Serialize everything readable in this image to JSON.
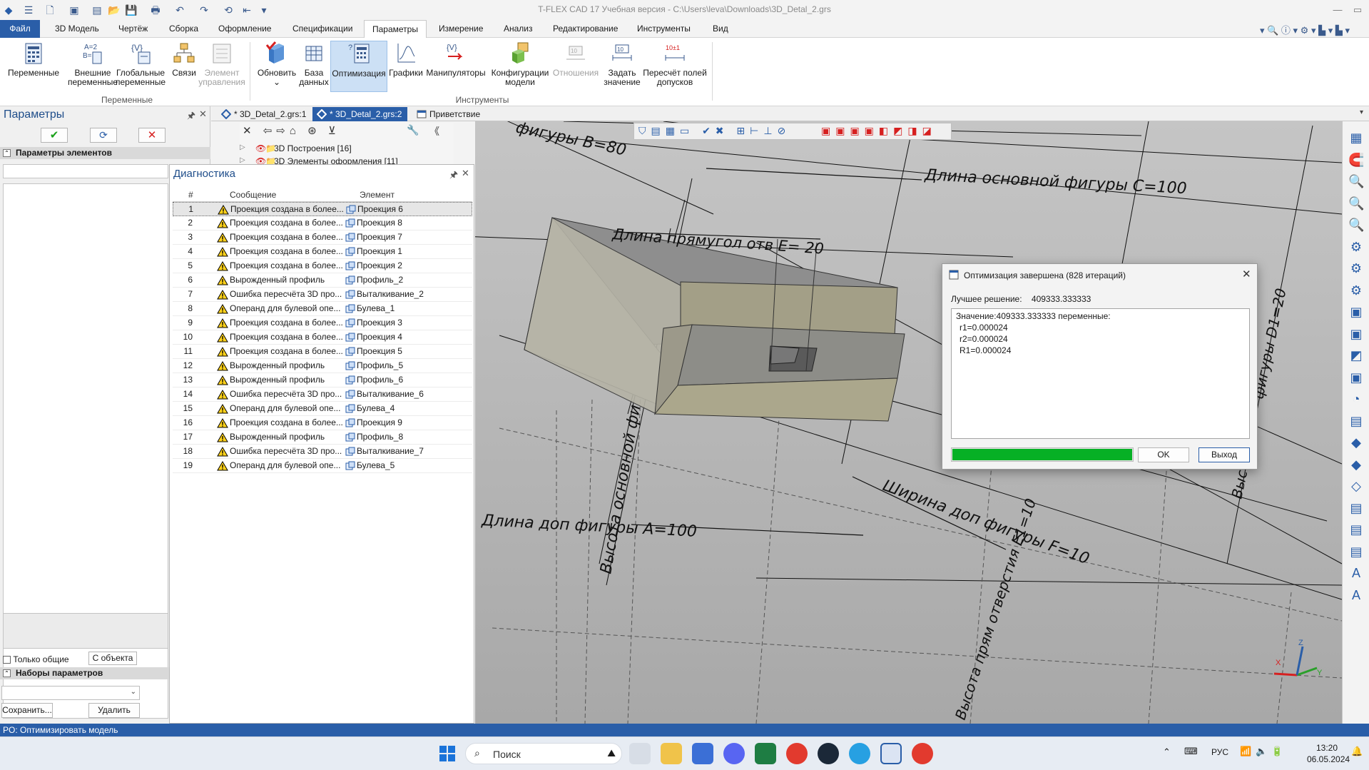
{
  "window": {
    "title": "T-FLEX CAD 17 Учебная версия - C:\\Users\\leva\\Downloads\\3D_Detal_2.grs"
  },
  "menu": {
    "tabs": [
      "Файл",
      "3D Модель",
      "Чертёж",
      "Сборка",
      "Оформление",
      "Спецификации",
      "Параметры",
      "Измерение",
      "Анализ",
      "Редактирование",
      "Инструменты",
      "Вид"
    ],
    "active": "Параметры"
  },
  "ribbon": {
    "buttons": [
      {
        "label1": "Переменные",
        "label2": ""
      },
      {
        "label1": "Внешние",
        "label2": "переменные"
      },
      {
        "label1": "Глобальные",
        "label2": "переменные"
      },
      {
        "label1": "Связи",
        "label2": ""
      },
      {
        "label1": "Элемент",
        "label2": "управления"
      },
      {
        "label1": "Обновить",
        "label2": "⌄"
      },
      {
        "label1": "База",
        "label2": "данных"
      },
      {
        "label1": "Оптимизация",
        "label2": ""
      },
      {
        "label1": "Графики",
        "label2": ""
      },
      {
        "label1": "Манипуляторы",
        "label2": ""
      },
      {
        "label1": "Конфигурации",
        "label2": "модели"
      },
      {
        "label1": "Отношения",
        "label2": ""
      },
      {
        "label1": "Задать",
        "label2": "значение"
      },
      {
        "label1": "Пересчёт полей",
        "label2": "допусков"
      }
    ],
    "groups": {
      "variables": "Переменные",
      "tools": "Инструменты"
    }
  },
  "params_panel": {
    "title": "Параметры",
    "elements_header": "Параметры элементов",
    "only_common": "Только общие",
    "from_object": "С объекта",
    "sets_header": "Наборы параметров",
    "save": "Сохранить...",
    "delete": "Удалить"
  },
  "doc_tabs": [
    {
      "label": "* 3D_Detal_2.grs:1"
    },
    {
      "label": "* 3D_Detal_2.grs:2"
    },
    {
      "label": "Приветствие"
    }
  ],
  "tree": {
    "rows": [
      "3D Построения [16]",
      "3D Элементы оформления [11]"
    ]
  },
  "diagnostics": {
    "title": "Диагностика",
    "headers": {
      "num": "#",
      "message": "Сообщение",
      "element": "Элемент"
    },
    "rows": [
      {
        "n": "1",
        "msg": "Проекция создана в более...",
        "el": "Проекция 6"
      },
      {
        "n": "2",
        "msg": "Проекция создана в более...",
        "el": "Проекция 8"
      },
      {
        "n": "3",
        "msg": "Проекция создана в более...",
        "el": "Проекция 7"
      },
      {
        "n": "4",
        "msg": "Проекция создана в более...",
        "el": "Проекция 1"
      },
      {
        "n": "5",
        "msg": "Проекция создана в более...",
        "el": "Проекция 2"
      },
      {
        "n": "6",
        "msg": "Вырожденный профиль",
        "el": "Профиль_2"
      },
      {
        "n": "7",
        "msg": "Ошибка пересчёта 3D про...",
        "el": "Выталкивание_2"
      },
      {
        "n": "8",
        "msg": "Операнд для булевой опе...",
        "el": "Булева_1"
      },
      {
        "n": "9",
        "msg": "Проекция создана в более...",
        "el": "Проекция 3"
      },
      {
        "n": "10",
        "msg": "Проекция создана в более...",
        "el": "Проекция 4"
      },
      {
        "n": "11",
        "msg": "Проекция создана в более...",
        "el": "Проекция 5"
      },
      {
        "n": "12",
        "msg": "Вырожденный профиль",
        "el": "Профиль_5"
      },
      {
        "n": "13",
        "msg": "Вырожденный профиль",
        "el": "Профиль_6"
      },
      {
        "n": "14",
        "msg": "Ошибка пересчёта 3D про...",
        "el": "Выталкивание_6"
      },
      {
        "n": "15",
        "msg": "Операнд для булевой опе...",
        "el": "Булева_4"
      },
      {
        "n": "16",
        "msg": "Проекция создана в более...",
        "el": "Проекция 9"
      },
      {
        "n": "17",
        "msg": "Вырожденный профиль",
        "el": "Профиль_8"
      },
      {
        "n": "18",
        "msg": "Ошибка пересчёта 3D про...",
        "el": "Выталкивание_7"
      },
      {
        "n": "19",
        "msg": "Операнд для булевой опе...",
        "el": "Булева_5"
      }
    ]
  },
  "viewport": {
    "dims": {
      "c": "Длина основной фигуры C=100",
      "e": "Длина прямугол отв E= 20",
      "b": "фигуры B=80",
      "dop": "Длина доп фигуры A=100",
      "wid": "Ширина доп фигуры F=10",
      "h1": "Высота основной фи",
      "h2": "Высота прям отверстия E1=10",
      "d1": "фигуры D1=20",
      "vy": "Выс"
    },
    "axes": {
      "x": "X",
      "y": "Y",
      "z": "Z"
    }
  },
  "dialog": {
    "title": "Оптимизация завершена (828 итераций)",
    "best_label": "Лучшее решение:",
    "best_value": "409333.333333",
    "lines": [
      "Значение:409333.333333 переменные:",
      "r1=0.000024",
      "r2=0.000024",
      "R1=0.000024"
    ],
    "progress": 1.0,
    "ok": "OK",
    "exit": "Выход"
  },
  "status": {
    "text": "PO: Оптимизировать модель"
  },
  "taskbar": {
    "search": "Поиск",
    "lang": "РУС",
    "time": "13:20",
    "date": "06.05.2024"
  },
  "colors": {
    "accent": "#2a5ea8",
    "progress": "#06b025"
  }
}
